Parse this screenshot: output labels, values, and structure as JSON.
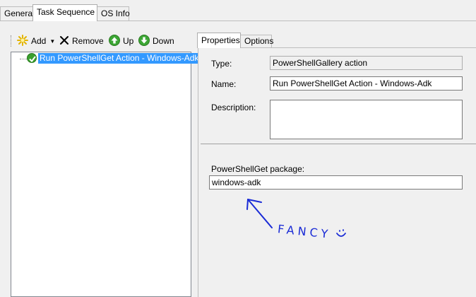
{
  "tabs": [
    "General",
    "Task Sequence",
    "OS Info"
  ],
  "toolbar": {
    "add": "Add",
    "remove": "Remove",
    "up": "Up",
    "down": "Down"
  },
  "tree": {
    "item": "Run PowerShellGet Action - Windows-Adk"
  },
  "right_tabs": [
    "Properties",
    "Options"
  ],
  "form": {
    "type_label": "Type:",
    "type_value": "PowerShellGallery action",
    "name_label": "Name:",
    "name_value": "Run PowerShellGet Action - Windows-Adk",
    "description_label": "Description:",
    "description_value": "",
    "package_label": "PowerShellGet package:",
    "package_value": "windows-adk"
  },
  "annotation": {
    "text": "FANCY"
  },
  "colors": {
    "selection": "#3399ff",
    "ink": "#1a2bd6"
  }
}
